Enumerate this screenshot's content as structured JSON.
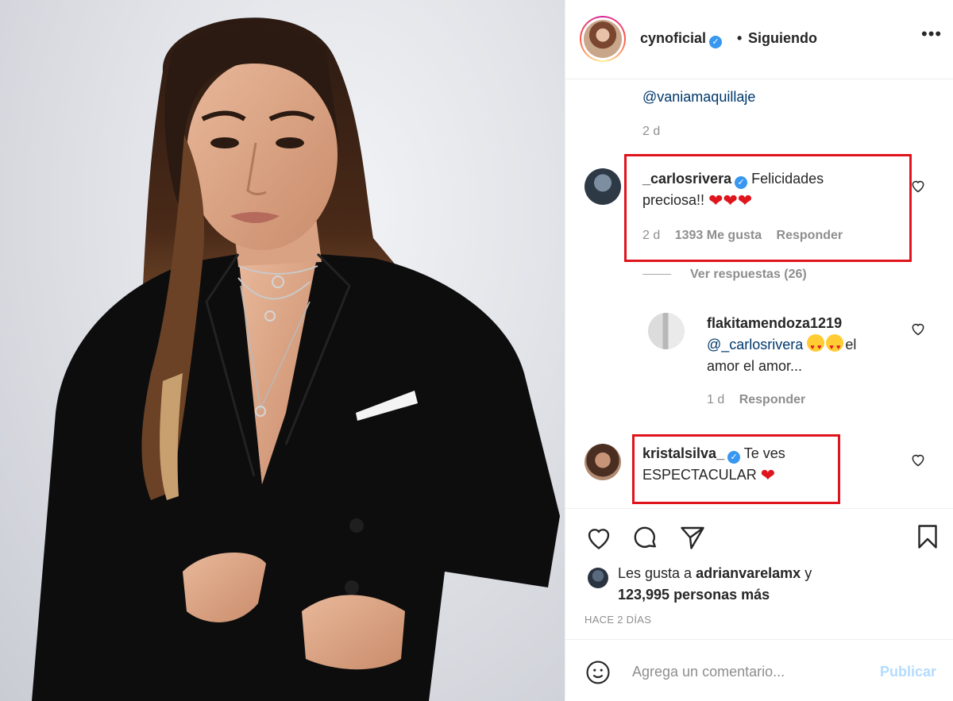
{
  "header": {
    "username": "cynoficial",
    "verified_mark": "✓",
    "separator": "•",
    "follow_status": "Siguiendo",
    "more_label": "•••"
  },
  "caption_tail": {
    "mention": "@vaniamaquillaje",
    "time": "2 d"
  },
  "comments": [
    {
      "username": "_carlosrivera",
      "text": "Felicidades",
      "text_line2": "preciosa!!",
      "emoji": "❤❤❤",
      "time": "2 d",
      "likes": "1393 Me gusta",
      "reply_label": "Responder"
    },
    {
      "view_replies": "Ver respuestas (26)"
    },
    {
      "username": "flakitamendoza1219",
      "mention": "@_carlosrivera",
      "text_after": "el",
      "text_line3": "amor el amor...",
      "time": "1 d",
      "reply_label": "Responder"
    },
    {
      "username": "kristalsilva_",
      "text": "Te ves",
      "text_line2": "ESPECTACULAR",
      "emoji": "❤"
    }
  ],
  "likes": {
    "prefix": "Les gusta a",
    "user": "adrianvarelamx",
    "suffix": "y",
    "count_text": "123,995 personas más"
  },
  "time_ago": "HACE 2 DÍAS",
  "add_comment": {
    "placeholder": "Agrega un comentario...",
    "publish_label": "Publicar"
  },
  "icons": {
    "like": "heart-icon",
    "comment": "comment-bubble-icon",
    "share": "paper-plane-icon",
    "save": "bookmark-icon",
    "emoji": "smiley-icon"
  },
  "colors": {
    "link": "#00376b",
    "muted": "#8e8e8e",
    "highlight_box": "#e0141c",
    "publish_disabled": "#b3dbff",
    "verified": "#3897f0"
  }
}
